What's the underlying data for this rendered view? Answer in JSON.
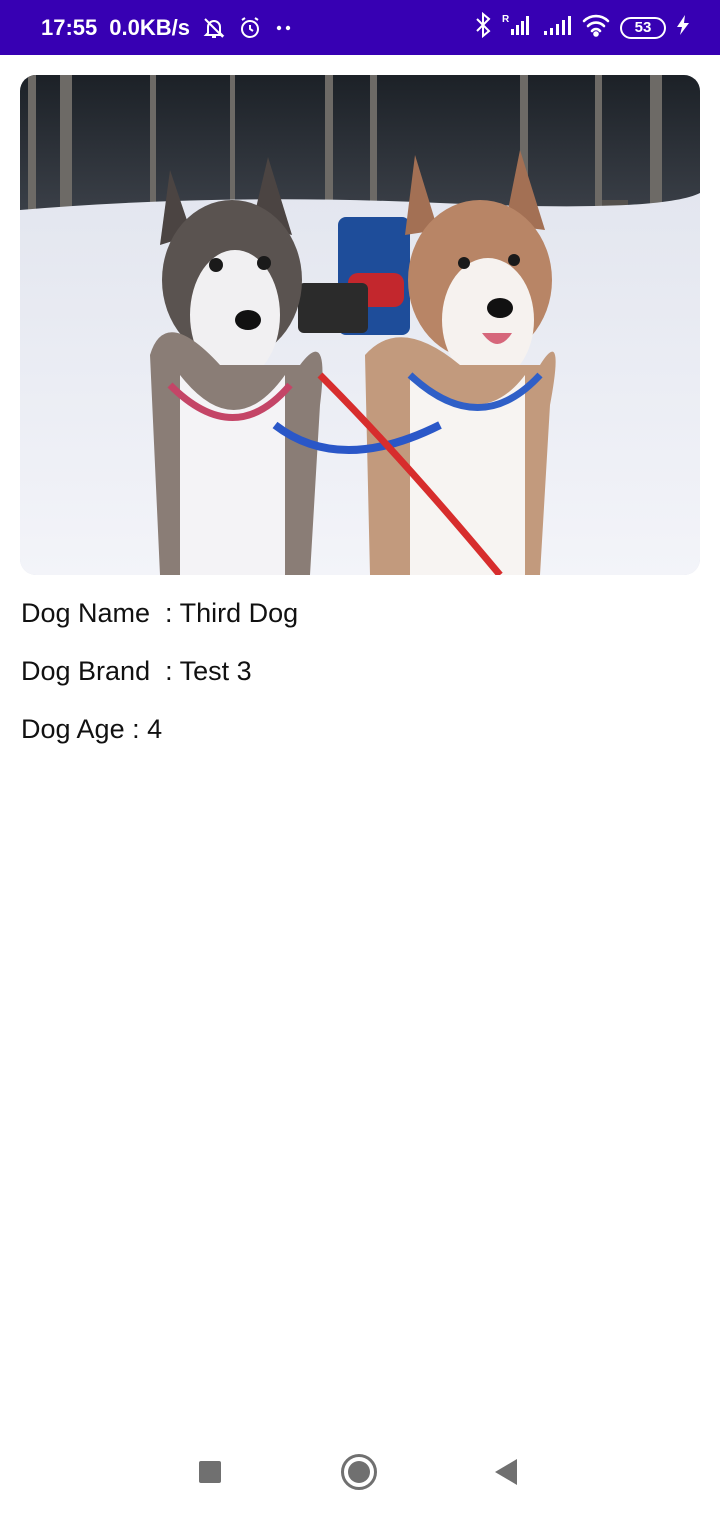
{
  "status_bar": {
    "time": "17:55",
    "network_speed": "0.0KB/s",
    "battery_level": "53",
    "background_color": "#3700b3",
    "icons": [
      "bell-muted-icon",
      "alarm-icon",
      "more-dots-icon",
      "bluetooth-icon",
      "signal-roaming-icon",
      "signal-icon",
      "wifi-icon",
      "battery-icon",
      "charging-icon"
    ]
  },
  "dog": {
    "name_line": "Dog Name  : Third Dog",
    "brand_line": "Dog Brand  : Test 3",
    "age_line": "Dog Age : 4",
    "photo_icon": "husky-photo"
  },
  "nav_bar": {
    "icons": [
      "recents-square-icon",
      "home-circle-icon",
      "back-triangle-icon"
    ]
  }
}
